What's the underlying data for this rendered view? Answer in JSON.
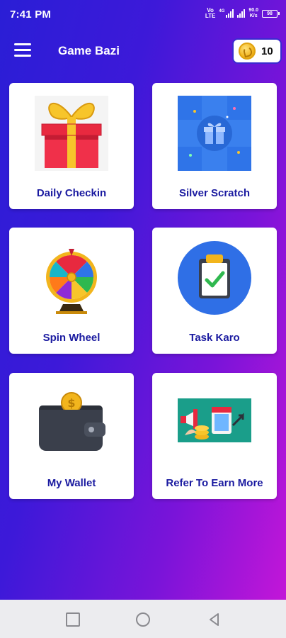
{
  "status_bar": {
    "time": "7:41 PM",
    "volte_top": "Vo",
    "volte_bottom": "LTE",
    "network_type": "4G",
    "speed_value": "90.0",
    "speed_unit": "K/s",
    "battery": "98"
  },
  "app_bar": {
    "title": "Game Bazi",
    "coins": "10"
  },
  "cards": {
    "daily_checkin": {
      "label": "Daily Checkin",
      "icon": "gift-box-icon"
    },
    "silver_scratch": {
      "label": "Silver Scratch",
      "icon": "scratch-gift-icon"
    },
    "spin_wheel": {
      "label": "Spin Wheel",
      "icon": "spin-wheel-icon"
    },
    "task_karo": {
      "label": "Task Karo",
      "icon": "clipboard-check-icon"
    },
    "my_wallet": {
      "label": "My Wallet",
      "icon": "wallet-icon"
    },
    "refer": {
      "label": "Refer To Earn More",
      "icon": "refer-earn-icon"
    }
  },
  "colors": {
    "gradient_start": "#2a1ed6",
    "gradient_end": "#c316d8",
    "card_label": "#1a1aa0"
  }
}
